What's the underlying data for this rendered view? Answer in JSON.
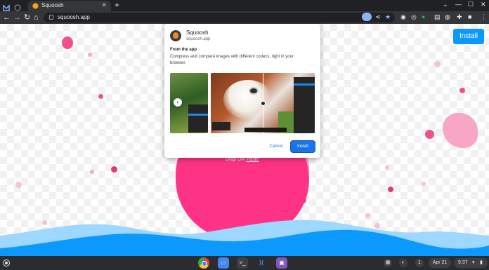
{
  "browser": {
    "tab_title": "Squoosh",
    "tab_close": "✕",
    "new_tab": "+",
    "url": "squoosh.app",
    "window_controls": [
      "⌄",
      "—",
      "☐",
      "✕"
    ],
    "nav": {
      "back": "←",
      "forward": "→",
      "reload": "↻",
      "home": "⌂"
    }
  },
  "page": {
    "install_button": "Install",
    "drop_text": "Drop OR",
    "paste_link": "Paste",
    "accent_color": "#ff3385",
    "wave_color": "#0c99ff"
  },
  "dialog": {
    "app_name": "Squoosh",
    "app_host": "squoosh.app",
    "from_heading": "From the app",
    "description": "Compress and compare images with different codecs, right in your browser.",
    "prev_arrow": "‹",
    "cancel_label": "Cancel",
    "install_label": "Install"
  },
  "shelf": {
    "apps": [
      "chrome-icon",
      "files-icon",
      "terminal-icon",
      "vscode-icon",
      "app-icon"
    ],
    "date": "Apr 21",
    "time": "9:37",
    "notification_count": "1"
  }
}
